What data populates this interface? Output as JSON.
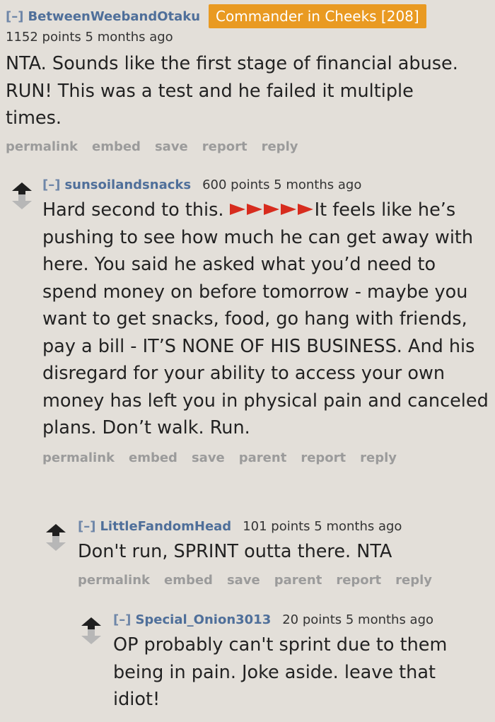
{
  "comments": [
    {
      "toggle": "[–]",
      "author": "BetweenWeebandOtaku",
      "flair": "Commander in Cheeks [208]",
      "meta": "1152 points 5 months ago",
      "body": "NTA. Sounds like the first stage of financial abuse. RUN! This was a test and he failed it multiple times.",
      "actions": [
        "permalink",
        "embed",
        "save",
        "report",
        "reply"
      ]
    },
    {
      "toggle": "[–]",
      "author": "sunsoilandsnacks",
      "meta": "600 points 5 months ago",
      "body_pre": "Hard second to this. ",
      "body_post": "It feels like he’s pushing to see how much he can get away with here. You said he asked what you’d need to spend money on before tomorrow - maybe you want to get snacks, food, go hang with friends, pay a bill - IT’S NONE OF HIS BUSINESS. And his disregard for your ability to access your own money has left you in physical pain and canceled plans. Don’t walk. Run.",
      "flag_icon": "red-triangle-flag-icon",
      "flag_count": 5,
      "actions": [
        "permalink",
        "embed",
        "save",
        "parent",
        "report",
        "reply"
      ]
    },
    {
      "toggle": "[–]",
      "author": "LittleFandomHead",
      "meta": "101 points 5 months ago",
      "body": "Don't run, SPRINT outta there. NTA",
      "actions": [
        "permalink",
        "embed",
        "save",
        "parent",
        "report",
        "reply"
      ]
    },
    {
      "toggle": "[–]",
      "author": "Special_Onion3013",
      "meta": "20 points 5 months ago",
      "body": "OP probably can't sprint due to them being in pain. Joke aside. leave that idiot!"
    }
  ],
  "colors": {
    "background": "#e3dfd9",
    "author": "#4f6f9a",
    "flair_bg": "#e99a22",
    "action": "#9b9b9b",
    "flag": "#d72c1e"
  }
}
